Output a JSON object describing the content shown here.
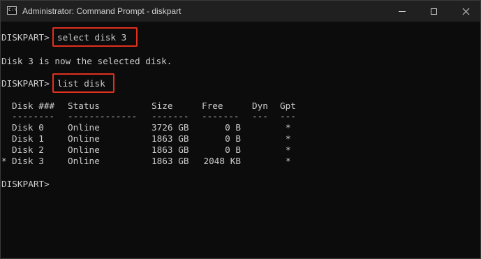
{
  "window": {
    "title": "Administrator: Command Prompt - diskpart",
    "icon": "cmd-icon",
    "icon_glyph": "C:\\"
  },
  "console": {
    "prompt": "DISKPART>",
    "command1": "select disk 3",
    "response1": "Disk 3 is now the selected disk.",
    "command2": "list disk",
    "table": {
      "headers": [
        "Disk ###",
        "Status",
        "Size",
        "Free",
        "Dyn",
        "Gpt"
      ],
      "separators": [
        "--------",
        "-------------",
        "-------",
        "-------",
        "---",
        "---"
      ],
      "rows": [
        {
          "marker": "",
          "disk": "Disk 0",
          "status": "Online",
          "size": "3726 GB",
          "free": "0 B",
          "dyn": "",
          "gpt": "*"
        },
        {
          "marker": "",
          "disk": "Disk 1",
          "status": "Online",
          "size": "1863 GB",
          "free": "0 B",
          "dyn": "",
          "gpt": "*"
        },
        {
          "marker": "",
          "disk": "Disk 2",
          "status": "Online",
          "size": "1863 GB",
          "free": "0 B",
          "dyn": "",
          "gpt": "*"
        },
        {
          "marker": "*",
          "disk": "Disk 3",
          "status": "Online",
          "size": "1863 GB",
          "free": "2048 KB",
          "dyn": "",
          "gpt": "*"
        }
      ]
    },
    "final_prompt": "DISKPART>"
  },
  "colors": {
    "background": "#0c0c0c",
    "titlebar": "#202020",
    "text": "#cccccc",
    "highlight": "#e0301e"
  }
}
